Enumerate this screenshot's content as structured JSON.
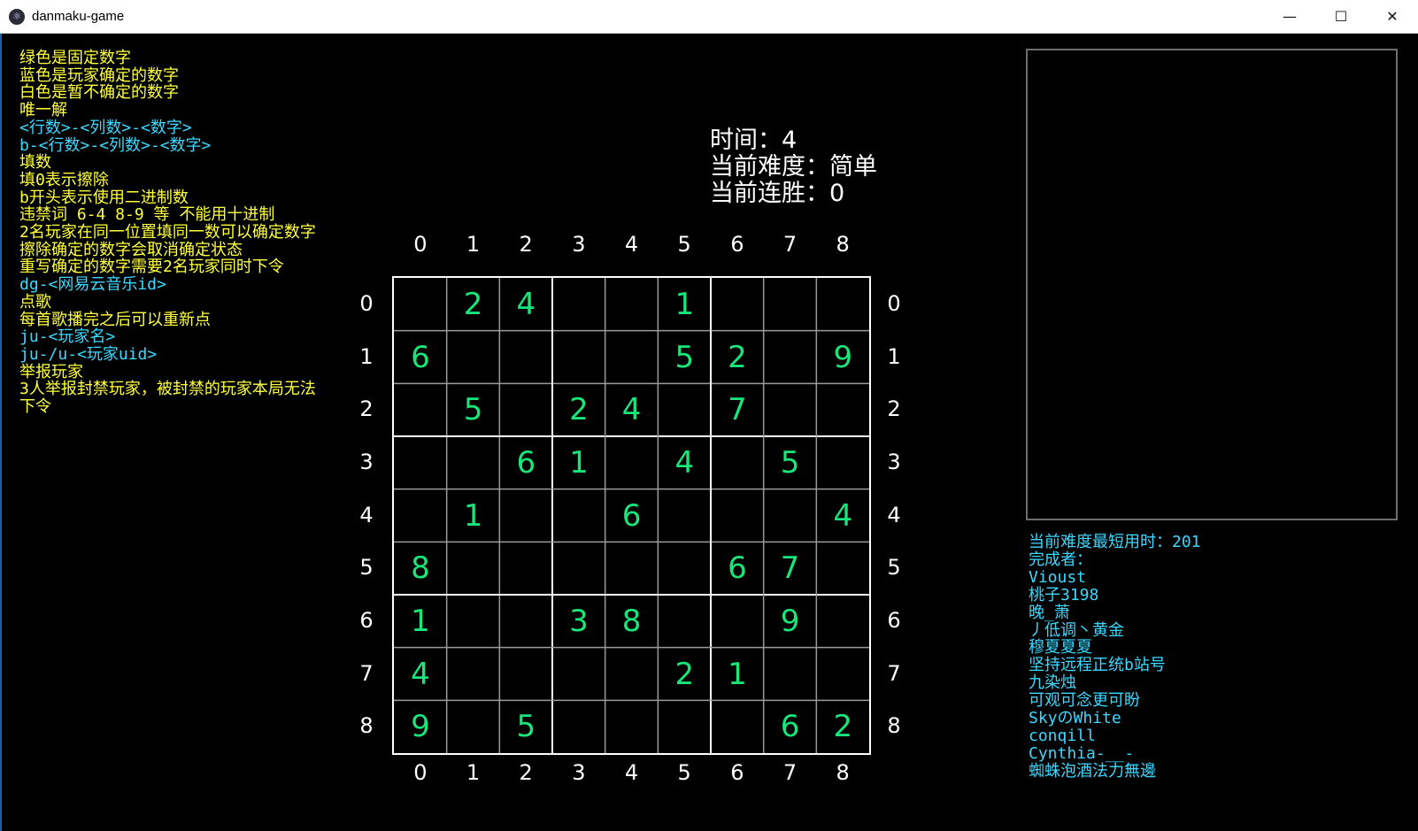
{
  "window": {
    "title": "danmaku-game",
    "minimize_glyph": "—",
    "maximize_glyph": "☐",
    "close_glyph": "✕",
    "app_icon": "⚛"
  },
  "instructions": [
    {
      "text": "绿色是固定数字",
      "color": "yellow"
    },
    {
      "text": "蓝色是玩家确定的数字",
      "color": "yellow"
    },
    {
      "text": "白色是暂不确定的数字",
      "color": "yellow"
    },
    {
      "text": "唯一解",
      "color": "yellow"
    },
    {
      "text": "<行数>-<列数>-<数字>",
      "color": "cyan"
    },
    {
      "text": "b-<行数>-<列数>-<数字>",
      "color": "cyan"
    },
    {
      "text": "填数",
      "color": "yellow"
    },
    {
      "text": "填0表示擦除",
      "color": "yellow"
    },
    {
      "text": "b开头表示使用二进制数",
      "color": "yellow"
    },
    {
      "text": "违禁词 6-4 8-9 等 不能用十进制",
      "color": "yellow"
    },
    {
      "text": "2名玩家在同一位置填同一数可以确定数字",
      "color": "yellow"
    },
    {
      "text": "擦除确定的数字会取消确定状态",
      "color": "yellow"
    },
    {
      "text": "重写确定的数字需要2名玩家同时下令",
      "color": "yellow"
    },
    {
      "text": "dg-<网易云音乐id>",
      "color": "cyan"
    },
    {
      "text": "点歌",
      "color": "yellow"
    },
    {
      "text": "每首歌播完之后可以重新点",
      "color": "yellow"
    },
    {
      "text": "ju-<玩家名>",
      "color": "cyan"
    },
    {
      "text": "ju-/u-<玩家uid>",
      "color": "cyan"
    },
    {
      "text": "举报玩家",
      "color": "yellow"
    },
    {
      "text": "3人举报封禁玩家，被封禁的玩家本局无法下令",
      "color": "yellow"
    }
  ],
  "status": {
    "time": "时间：4",
    "difficulty": "当前难度：简单",
    "streak": "当前连胜：0"
  },
  "board": {
    "col_labels": [
      "0",
      "1",
      "2",
      "3",
      "4",
      "5",
      "6",
      "7",
      "8"
    ],
    "row_labels": [
      "0",
      "1",
      "2",
      "3",
      "4",
      "5",
      "6",
      "7",
      "8"
    ],
    "fixed_color": "#19e67a",
    "cells": [
      [
        "",
        "2",
        "4",
        "",
        "",
        "1",
        "",
        "",
        ""
      ],
      [
        "6",
        "",
        "",
        "",
        "",
        "5",
        "2",
        "",
        "9"
      ],
      [
        "",
        "5",
        "",
        "2",
        "4",
        "",
        "7",
        "",
        ""
      ],
      [
        "",
        "",
        "6",
        "1",
        "",
        "4",
        "",
        "5",
        ""
      ],
      [
        "",
        "1",
        "",
        "",
        "6",
        "",
        "",
        "",
        "4"
      ],
      [
        "8",
        "",
        "",
        "",
        "",
        "",
        "6",
        "7",
        ""
      ],
      [
        "1",
        "",
        "",
        "3",
        "8",
        "",
        "",
        "9",
        ""
      ],
      [
        "4",
        "",
        "",
        "",
        "",
        "2",
        "1",
        "",
        ""
      ],
      [
        "9",
        "",
        "5",
        "",
        "",
        "",
        "",
        "6",
        "2"
      ]
    ]
  },
  "records": [
    "当前难度最短用时：201",
    "完成者：",
    "Vioust",
    "桃子3198",
    "晚_萧",
    "丿低调丶黄金",
    "穆夏夏夏",
    "坚持远程正统b站号",
    "九染烛",
    "可观可念更可盼",
    "SkyのWhite",
    "conqill",
    "Cynthia-__-",
    "蜘蛛泡酒法力無邊"
  ],
  "colors": {
    "yellow": "#ffff3c",
    "cyan": "#3cd8ff",
    "background": "#000000",
    "grid": "#ffffff"
  }
}
